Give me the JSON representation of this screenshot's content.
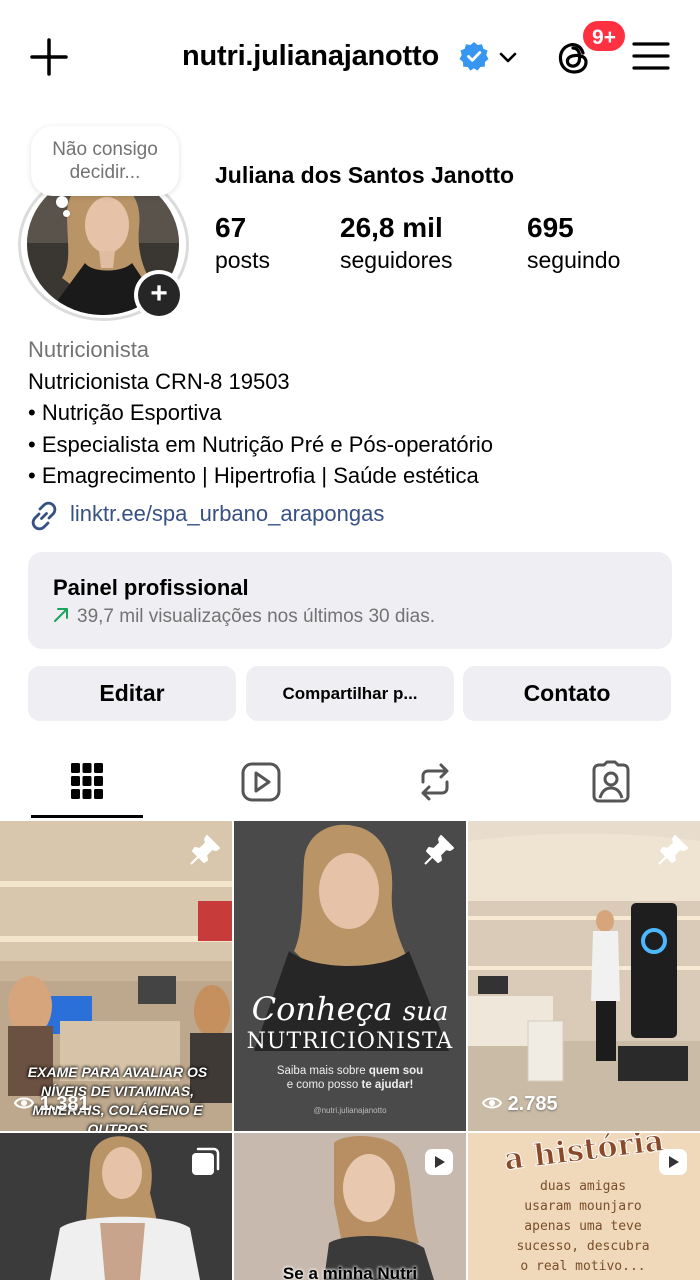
{
  "header": {
    "username": "nutri.julianajanotto",
    "notification_badge": "9+"
  },
  "profile": {
    "note": "Não consigo decidir...",
    "display_name": "Juliana dos Santos Janotto",
    "stats": [
      {
        "value": "67",
        "label": "posts"
      },
      {
        "value": "26,8 mil",
        "label": "seguidores"
      },
      {
        "value": "695",
        "label": "seguindo"
      }
    ],
    "category": "Nutricionista",
    "bio_lines": [
      "Nutricionista CRN-8 19503",
      "• Nutrição Esportiva",
      "• Especialista em Nutrição Pré e Pós-operatório",
      "• Emagrecimento | Hipertrofia | Saúde estética"
    ],
    "link": "linktr.ee/spa_urbano_arapongas"
  },
  "dashboard": {
    "title": "Painel profissional",
    "subtitle": "39,7 mil visualizações nos últimos 30 dias."
  },
  "actions": {
    "edit": "Editar",
    "share": "Compartilhar p...",
    "contact": "Contato"
  },
  "tabs": [
    "grid-icon",
    "reels-icon",
    "reposts-icon",
    "tagged-icon"
  ],
  "posts": [
    {
      "type": "reel",
      "pinned": true,
      "views": "1.381",
      "overlay": "EXAME PARA AVALIAR OS NÍVEIS DE VITAMINAS, MINERAIS, COLÁGENO E OUTROS"
    },
    {
      "type": "image",
      "pinned": true,
      "title1": "Conheça",
      "title2": "sua",
      "title3": "NUTRICIONISTA",
      "sub1": "Saiba mais sobre ",
      "sub1b": "quem sou",
      "sub2": "e como posso ",
      "sub2b": "te ajudar!",
      "handle": "@nutri.julianajanotto"
    },
    {
      "type": "reel",
      "pinned": true,
      "views": "2.785"
    },
    {
      "type": "carousel",
      "pinned": false
    },
    {
      "type": "reel",
      "pinned": false,
      "overlay": "Se a minha Nutri"
    },
    {
      "type": "reel",
      "pinned": false,
      "title": "a história",
      "text": "duas amigas usaram mounjaro apenas uma teve sucesso, descubra o real motivo..."
    }
  ],
  "colors": {
    "accent_blue": "#3797f0",
    "badge_red": "#ff3040",
    "link_blue": "#385185",
    "growth_green": "#1aa35a"
  }
}
